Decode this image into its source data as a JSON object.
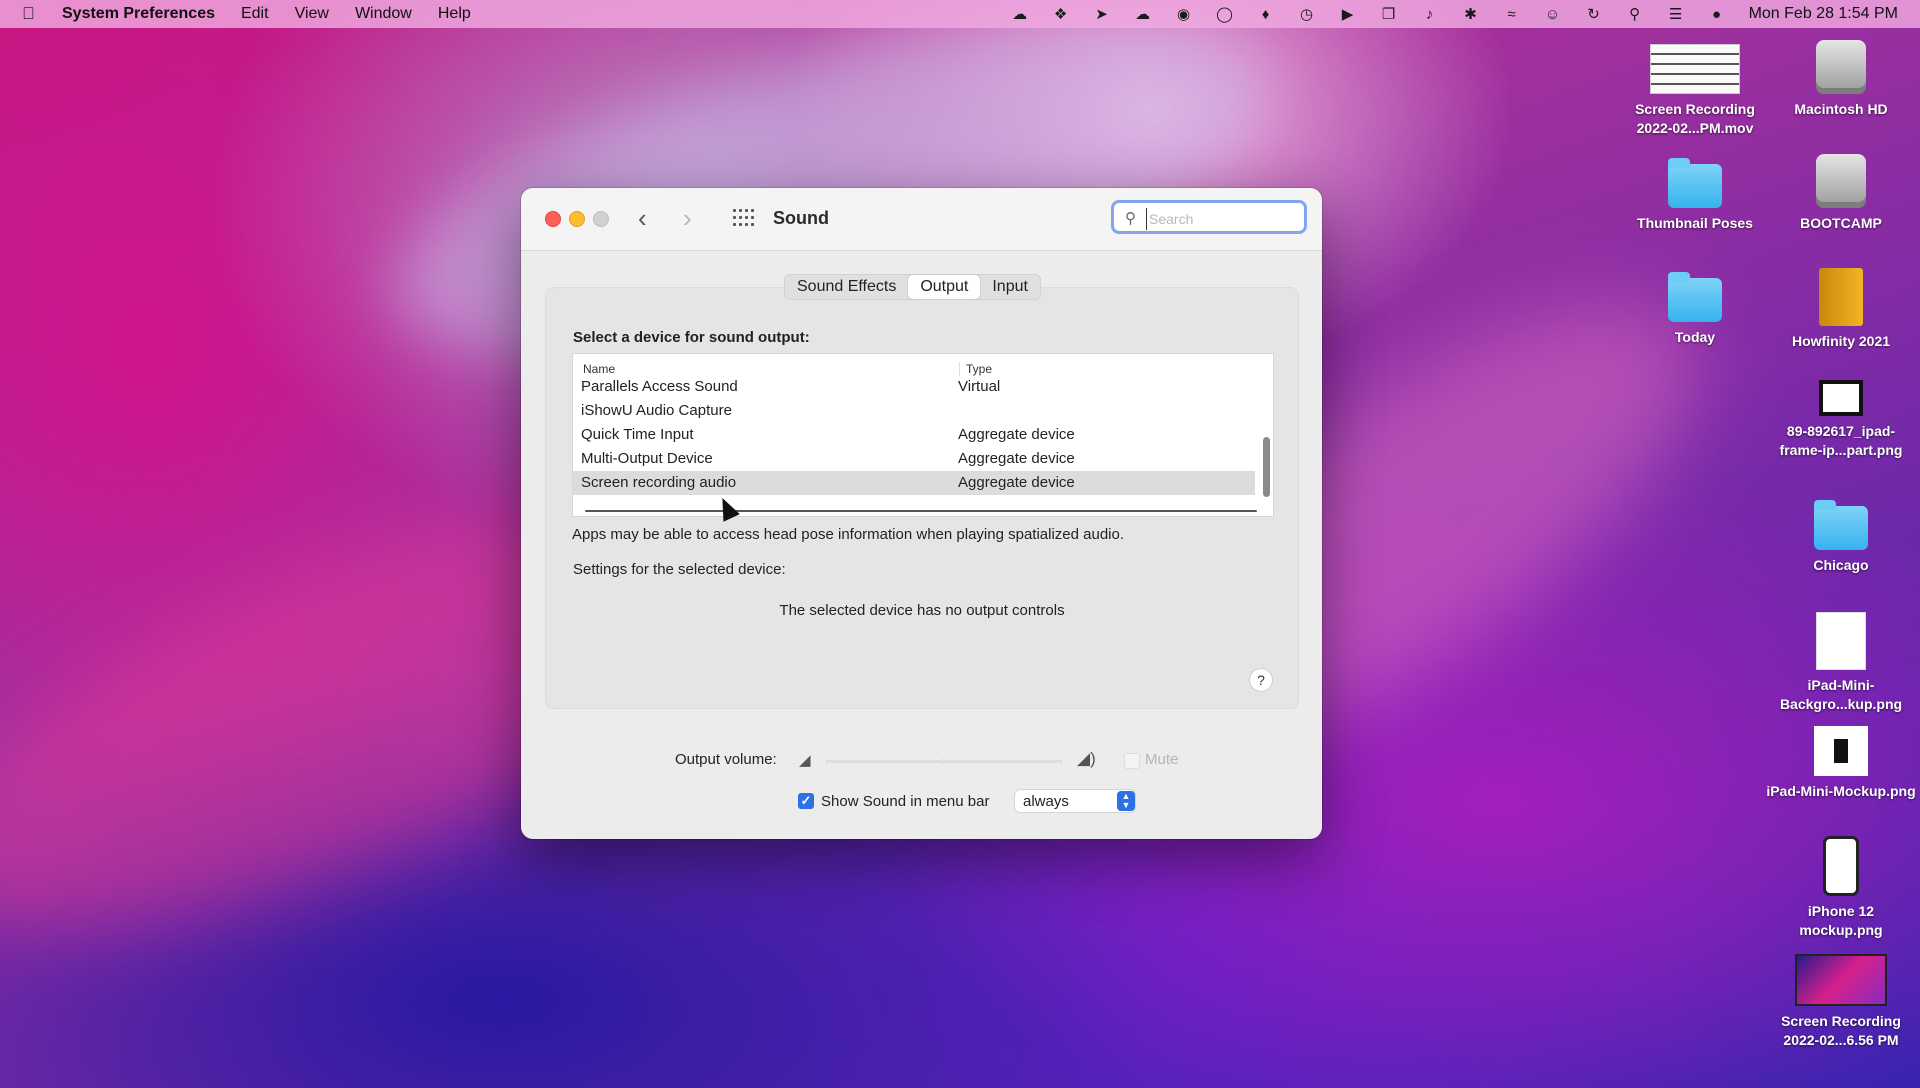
{
  "menubar": {
    "app_name": "System Preferences",
    "items": [
      "Edit",
      "View",
      "Window",
      "Help"
    ],
    "clock": "Mon Feb 28  1:54 PM",
    "status_icons": [
      "cloud-icon",
      "dropbox-icon",
      "pointer-icon",
      "upload-icon",
      "notification-app-icon",
      "onepassword-icon",
      "bell-icon",
      "clock-icon",
      "play-icon",
      "windows-icon",
      "volume-icon",
      "bluetooth-icon",
      "wifi-icon",
      "user-icon",
      "time-machine-icon",
      "search-icon",
      "control-center-icon",
      "siri-icon"
    ]
  },
  "desktop": {
    "icons": [
      {
        "label": "Screen Recording 2022-02...PM.mov",
        "kind": "movie"
      },
      {
        "label": "Macintosh HD",
        "kind": "hdd"
      },
      {
        "label": "Thumbnail Poses",
        "kind": "folder"
      },
      {
        "label": "BOOTCAMP",
        "kind": "hdd"
      },
      {
        "label": "Today",
        "kind": "folder"
      },
      {
        "label": "Howfinity 2021",
        "kind": "book"
      },
      {
        "label": "89-892617_ipad-frame-ip...part.png",
        "kind": "image"
      },
      {
        "label": "Chicago",
        "kind": "folder"
      },
      {
        "label": "iPad-Mini-Backgro...kup.png",
        "kind": "image"
      },
      {
        "label": "iPad-Mini-Mockup.png",
        "kind": "image"
      },
      {
        "label": "iPhone 12 mockup.png",
        "kind": "image"
      },
      {
        "label": "Screen Recording 2022-02...6.56 PM",
        "kind": "movie"
      }
    ]
  },
  "window": {
    "title": "Sound",
    "search_placeholder": "Search",
    "tabs": [
      "Sound Effects",
      "Output",
      "Input"
    ],
    "active_tab": "Output",
    "select_label": "Select a device for sound output:",
    "table": {
      "headers": [
        "Name",
        "Type"
      ],
      "rows": [
        {
          "name": "Parallels Access Sound",
          "type": "Virtual"
        },
        {
          "name": "iShowU Audio Capture",
          "type": ""
        },
        {
          "name": "Quick Time Input",
          "type": "Aggregate device"
        },
        {
          "name": "Multi-Output Device",
          "type": "Aggregate device"
        },
        {
          "name": "Screen recording audio",
          "type": "Aggregate device"
        }
      ],
      "selected_row": "Screen recording audio"
    },
    "head_pose_note": "Apps may be able to access head pose information when playing spatialized audio.",
    "settings_label": "Settings for the selected device:",
    "no_controls": "The selected device has no output controls",
    "help": "?",
    "output_volume_label": "Output volume:",
    "mute_label": "Mute",
    "show_sound_label": "Show Sound in menu bar",
    "show_sound_checked": true,
    "show_sound_option": "always"
  }
}
